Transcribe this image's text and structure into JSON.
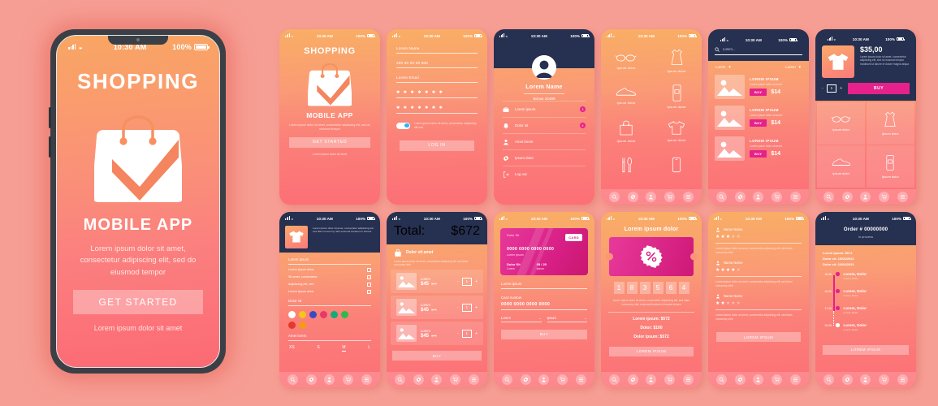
{
  "colors": {
    "background": "#f79e94",
    "gradient_start": "#f9a663",
    "gradient_end": "#fc6a74",
    "navy": "#263050",
    "accent_magenta": "#e6218b",
    "white": "#ffffff"
  },
  "hero": {
    "status": {
      "time": "10:30 AM",
      "battery": "100%"
    },
    "title": "SHOPPING",
    "subtitle": "MOBILE APP",
    "description": "Lorem ipsum dolor sit amet, consectetur adipiscing elit, sed do eiusmod tempor",
    "cta": "GET STARTED",
    "footer": "Lorem ipsum dolor sit amet",
    "icon": "shopping-bag-check-icon"
  },
  "status_bar": {
    "time": "10:30 AM",
    "battery": "100%"
  },
  "bottom_nav": [
    {
      "name": "search-icon",
      "label": "Search"
    },
    {
      "name": "gear-icon",
      "label": "Settings"
    },
    {
      "name": "person-icon",
      "label": "Profile"
    },
    {
      "name": "cart-icon",
      "label": "Cart"
    },
    {
      "name": "menu-icon",
      "label": "Menu"
    }
  ],
  "screens": {
    "onboarding": {
      "title": "SHOPPING",
      "subtitle": "MOBILE APP",
      "description": "Lorem ipsum dolor sit amet, consectetur adipiscing elit, sed do eiusmod tempor",
      "cta": "GET STARTED",
      "footer": "Lorem ipsum dolor sit amet"
    },
    "signup": {
      "fields": [
        {
          "label": "Lorem Name",
          "type": "text"
        },
        {
          "label": "360 00 00 00 000",
          "type": "tel"
        },
        {
          "label": "Lorem Email",
          "type": "email"
        },
        {
          "label": "✱ ✱ ✱ ✱ ✱ ✱ ✱",
          "type": "password"
        },
        {
          "label": "✱ ✱ ✱ ✱ ✱ ✱ ✱",
          "type": "password"
        }
      ],
      "toggle_on": true,
      "toggle_text": "Lorem ipsum dolor sit amet, consectetur adipiscing elit sed",
      "cta": "LOG IN"
    },
    "profile": {
      "name": "Lorem Name",
      "bonus": "Bonus  25489",
      "avatar": "user-avatar",
      "items": [
        {
          "icon": "briefcase-icon",
          "label": "Lorem ipsum",
          "badge": "3"
        },
        {
          "icon": "bell-icon",
          "label": "Dolor sit",
          "badge": "5"
        },
        {
          "icon": "person-icon",
          "label": "Amet lorem",
          "badge": ""
        },
        {
          "icon": "gear-icon",
          "label": "Ipsum dolor",
          "badge": ""
        },
        {
          "icon": "logout-icon",
          "label": "Log out",
          "badge": ""
        }
      ]
    },
    "categories": {
      "items": [
        {
          "icon": "glasses-icon",
          "label": "Ipsum dolor"
        },
        {
          "icon": "dress-icon",
          "label": "Ipsum dolor"
        },
        {
          "icon": "shoe-icon",
          "label": "Ipsum dolor"
        },
        {
          "icon": "cosmetic-icon",
          "label": "Ipsum dolor"
        },
        {
          "icon": "bag-icon",
          "label": "Ipsum dolor"
        },
        {
          "icon": "tshirt-icon",
          "label": "Ipsum dolor"
        },
        {
          "icon": "cutlery-icon",
          "label": ""
        },
        {
          "icon": "phone-icon",
          "label": ""
        }
      ]
    },
    "product_list": {
      "search_placeholder": "Lorem...",
      "filter_left": "Lorem",
      "filter_right": "Lorem",
      "items": [
        {
          "title": "LOREM IPSUM",
          "desc": "Lorem ipsum dolor sit amet",
          "buy": "BUY",
          "price": "$14"
        },
        {
          "title": "LOREM IPSUM",
          "desc": "Lorem ipsum dolor sit amet",
          "buy": "BUY",
          "price": "$14"
        },
        {
          "title": "LOREM IPSUM",
          "desc": "Lorem ipsum dolor sit amet",
          "buy": "BUY",
          "price": "$14"
        }
      ]
    },
    "product_detail": {
      "price": "$35,00",
      "desc": "Lorem ipsum dolor sit amet, consectetur adipiscing elit, sed do eiusmod tempor incididunt ut labore et dolore magna aliqua",
      "qty": "1",
      "minus": "-",
      "plus": "+",
      "buy": "BUY",
      "grid": [
        {
          "icon": "glasses-icon",
          "label": "Ipsum dolor"
        },
        {
          "icon": "dress-icon",
          "label": "Ipsum dolor"
        },
        {
          "icon": "shoe-icon",
          "label": "Ipsum dolor"
        },
        {
          "icon": "cosmetic-icon",
          "label": "Ipsum dolor"
        }
      ]
    },
    "product_options": {
      "desc": "Lorem ipsum dolor sit amet, consectetur adipiscing elit, sed diam nonummy nibh euismod tincidunt ut laoreet",
      "label_1": "Lorem ipsum",
      "checks": [
        {
          "label": "Lorem ipsum dolor",
          "checked": false
        },
        {
          "label": "Sit amet, consectetur",
          "checked": true
        },
        {
          "label": "Adipiscing elit, sed",
          "checked": false
        },
        {
          "label": "Lorem ipsum dolor",
          "checked": true
        }
      ],
      "label_2": "Dolor sit",
      "colors": [
        "#ffffff",
        "#f5c518",
        "#3b48c8",
        "#e8376c",
        "#13a97d",
        "#2db94d",
        "#e5372f",
        "#f59a15"
      ],
      "label_3": "Amet lorem",
      "sizes": [
        "XS",
        "S",
        "M",
        "L"
      ],
      "size_selected": "M"
    },
    "cart": {
      "total_label": "Total:",
      "total_value": "$672",
      "banner": "Dolor sit amet",
      "banner_desc": "Lorem ipsum dolor sit amet, consectetur adipiscing elit, sed diam nonummy nibh",
      "items": [
        {
          "name": "Lorem",
          "price": "$45",
          "old_price": "$79",
          "qty": "1"
        },
        {
          "name": "Lorem",
          "price": "$45",
          "old_price": "$79",
          "qty": "1"
        },
        {
          "name": "Lorem",
          "price": "$45",
          "old_price": "$79",
          "qty": "1"
        }
      ],
      "cta": "BUY"
    },
    "payment": {
      "card": {
        "brand_label": "Dolor Sit",
        "tag": "CARD",
        "number": "0000 0000 0000 0000",
        "holder": "Lorem ipsum",
        "label_left": "Dolor Sit",
        "value_left": "Lorem",
        "label_right": "05 / 25",
        "value_right": "Ipsum"
      },
      "field_name_label": "Lorem ipsum",
      "field_number_label": "Card number",
      "field_number_value": "0000 0000 0000 0000",
      "select_left": "Lorem",
      "select_right": "Ipsum",
      "cta": "BUY"
    },
    "coupon": {
      "title": "Lorem ipsum dolor",
      "ticket_icon": "percent-badge-icon",
      "digits": [
        "1",
        "8",
        "3",
        "5",
        "6",
        "4"
      ],
      "desc": "Lorem ipsum dolor sit amet, consectetur adipiscing elit, sed diam nonummy nibh euismod tincidunt ut laoreet dolore",
      "lines": [
        "Lorem ipsum: $572",
        "Dolor: $100",
        "Dolor ipsum: $572"
      ],
      "cta": "LOREM IPSUM"
    },
    "reviews": {
      "items": [
        {
          "name": "Name Name",
          "stars": 3,
          "text": "Lorem ipsum dolor sit amet, consectetur adipiscing elit, sed diam nonummy nibh"
        },
        {
          "name": "Name Name",
          "stars": 4,
          "text": "Lorem ipsum dolor sit amet, consectetur adipiscing elit, sed diam nonummy nibh"
        },
        {
          "name": "Name Name",
          "stars": 2,
          "text": "Lorem ipsum dolor sit amet, consectetur adipiscing elit, sed diam nonummy nibh"
        }
      ],
      "max_stars": 5,
      "cta": "LOREM IPSUM"
    },
    "order": {
      "number": "Order # 00000000",
      "status": "in process",
      "meta": [
        "Lorem ipsum: $572",
        "Dolor sit: 15/06/2021",
        "Dolor sit: 23/06/2021"
      ],
      "timeline": [
        {
          "time": "15.06",
          "title": "Lorem, Dolor",
          "sub": "Lorem, Dolor",
          "done": true
        },
        {
          "time": "16.06",
          "title": "Lorem, Dolor",
          "sub": "Lorem, Dolor",
          "done": true
        },
        {
          "time": "17.06",
          "title": "Lorem, Dolor",
          "sub": "Lorem, Dolor",
          "done": true
        },
        {
          "time": "20.06",
          "title": "Lorem, Dolor",
          "sub": "Lorem, Dolor",
          "done": false
        }
      ],
      "cta": "LOREM IPSUM"
    }
  }
}
